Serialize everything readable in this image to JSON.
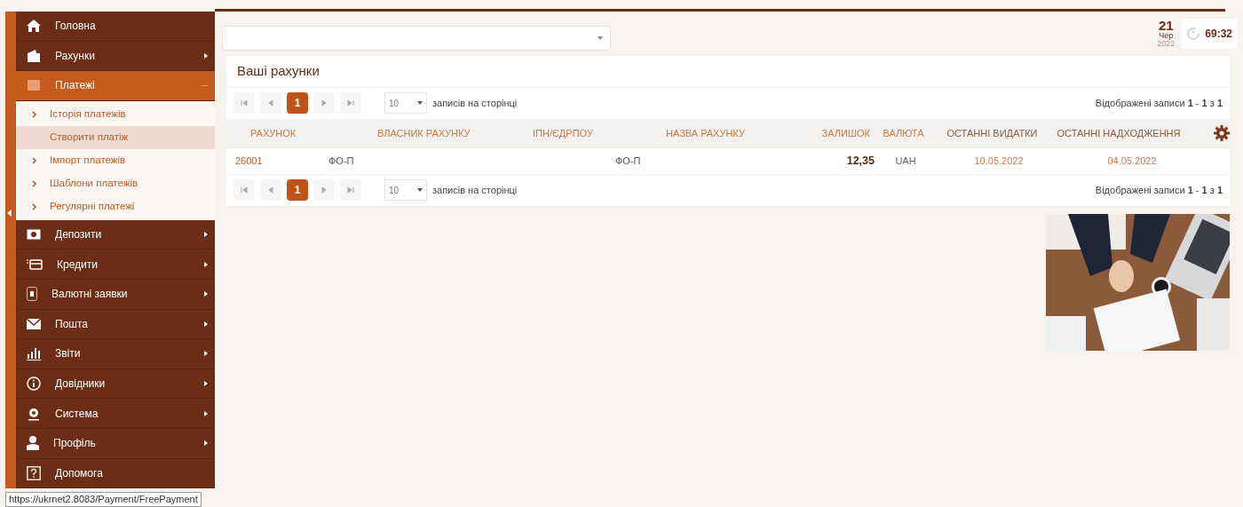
{
  "sidebar": {
    "items": [
      {
        "label": "Головна",
        "has_submenu": false,
        "expanded": false,
        "selected": false
      },
      {
        "label": "Рахунки",
        "has_submenu": true,
        "expanded": false,
        "selected": false
      },
      {
        "label": "Платежі",
        "has_submenu": true,
        "expanded": true,
        "selected": true,
        "children": [
          {
            "label": "Історія платежів",
            "selected": false
          },
          {
            "label": "Створити платіж",
            "selected": true
          },
          {
            "label": "Імпорт платежів",
            "selected": false
          },
          {
            "label": "Шаблони платежів",
            "selected": false
          },
          {
            "label": "Регулярні платежі",
            "selected": false
          }
        ]
      },
      {
        "label": "Депозити",
        "has_submenu": true,
        "expanded": false,
        "selected": false
      },
      {
        "label": "Кредити",
        "has_submenu": true,
        "expanded": false,
        "selected": false
      },
      {
        "label": "Валютні заявки",
        "has_submenu": true,
        "expanded": false,
        "selected": false
      },
      {
        "label": "Пошта",
        "has_submenu": true,
        "expanded": false,
        "selected": false
      },
      {
        "label": "Звіти",
        "has_submenu": true,
        "expanded": false,
        "selected": false
      },
      {
        "label": "Довідники",
        "has_submenu": true,
        "expanded": false,
        "selected": false
      },
      {
        "label": "Система",
        "has_submenu": true,
        "expanded": false,
        "selected": false
      },
      {
        "label": "Профіль",
        "has_submenu": true,
        "expanded": false,
        "selected": false
      },
      {
        "label": "Допомога",
        "has_submenu": false,
        "expanded": false,
        "selected": false
      }
    ]
  },
  "status_bar": {
    "url": "https://ukrnet2.8083/Payment/FreePayment"
  },
  "collapse_sidebar": true,
  "header": {
    "date": {
      "day": "21",
      "month": "Чер",
      "year": "2022"
    },
    "timer": "69:32"
  },
  "panel": {
    "title": "Ваші рахунки",
    "pagers": [
      {
        "pages": [
          {
            "label": "1",
            "selected": true
          }
        ],
        "page_size": "10",
        "page_size_label": "записів на сторінці",
        "info": "Відображені записи **1** - **1** з **1**"
      },
      {
        "pages": [
          {
            "label": "1",
            "selected": true
          }
        ],
        "page_size": "10",
        "page_size_label": "записів на сторінці",
        "info": "Відображені записи **1** - **1** з **1**"
      }
    ],
    "table": {
      "columns": [
        "РАХУНОК",
        "ВЛАСНИК РАХУНКУ",
        "ІПН/ЄДРПОУ",
        "НАЗВА РАХУНКУ",
        "ЗАЛИШОК",
        "ВАЛЮТА",
        "ОСТАННІ ВИДАТКИ",
        "ОСТАННІ НАДХОДЖЕННЯ"
      ],
      "rows": [
        {
          "account": "26001",
          "owner": "ФО-П",
          "name": "ФО-П",
          "balance": "12,35",
          "currency": "UAH",
          "last_expense": "10.05.2022",
          "last_income": "04.05.2022"
        }
      ]
    }
  }
}
